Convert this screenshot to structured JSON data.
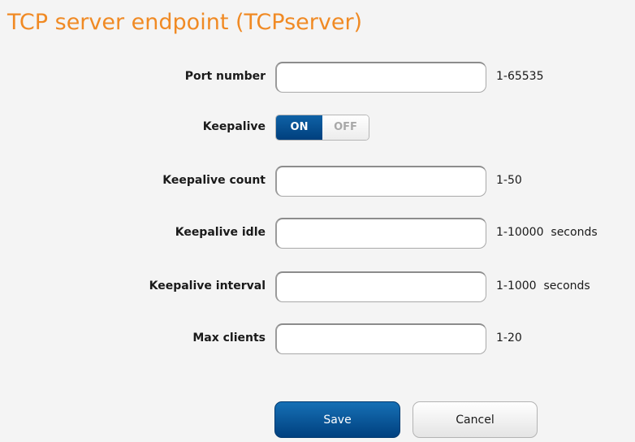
{
  "page": {
    "title": "TCP server endpoint (TCPserver)"
  },
  "form": {
    "port_number": {
      "label": "Port number",
      "value": "",
      "hint": "1-65535"
    },
    "keepalive": {
      "label": "Keepalive",
      "on_label": "ON",
      "off_label": "OFF",
      "state": "ON"
    },
    "keepalive_count": {
      "label": "Keepalive count",
      "value": "",
      "hint": "1-50"
    },
    "keepalive_idle": {
      "label": "Keepalive idle",
      "value": "",
      "hint": "1-10000  seconds"
    },
    "keepalive_interval": {
      "label": "Keepalive interval",
      "value": "",
      "hint": "1-1000  seconds"
    },
    "max_clients": {
      "label": "Max clients",
      "value": "",
      "hint": "1-20"
    }
  },
  "actions": {
    "save_label": "Save",
    "cancel_label": "Cancel"
  },
  "colors": {
    "title": "#f08a24",
    "primary_button": "#0b5a9c",
    "background": "#f4f4f4"
  }
}
